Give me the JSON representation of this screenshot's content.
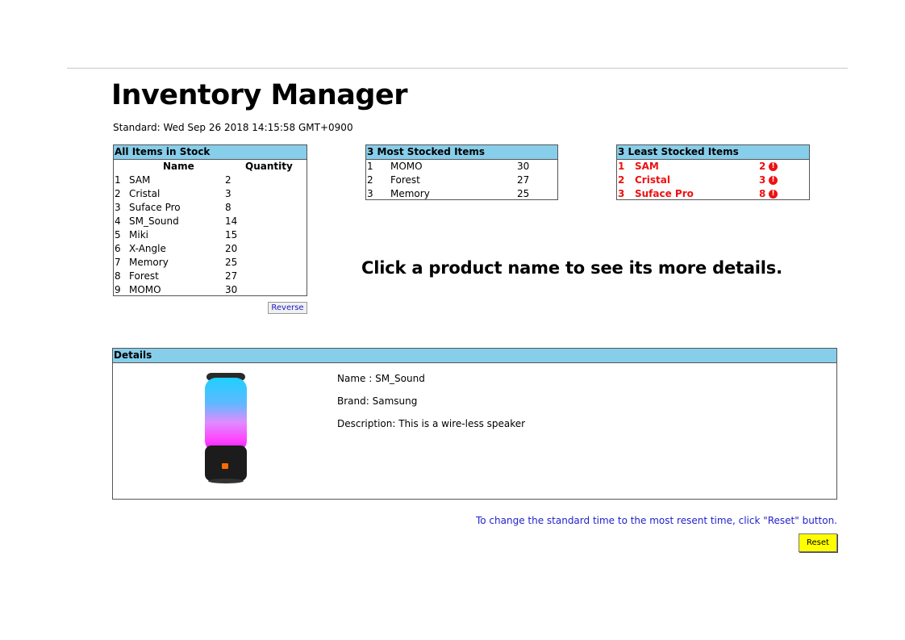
{
  "page": {
    "title": "Inventory Manager",
    "standard_time": "Standard: Wed Sep 26 2018 14:15:58 GMT+0900",
    "hint": "Click a product name to see its more details."
  },
  "all_items": {
    "header": "All Items in Stock",
    "col_name": "Name",
    "col_quantity": "Quantity",
    "rows": [
      {
        "index": "1",
        "name": "SAM",
        "quantity": "2"
      },
      {
        "index": "2",
        "name": "Cristal",
        "quantity": "3"
      },
      {
        "index": "3",
        "name": "Suface Pro",
        "quantity": "8"
      },
      {
        "index": "4",
        "name": "SM_Sound",
        "quantity": "14"
      },
      {
        "index": "5",
        "name": "Miki",
        "quantity": "15"
      },
      {
        "index": "6",
        "name": "X-Angle",
        "quantity": "20"
      },
      {
        "index": "7",
        "name": "Memory",
        "quantity": "25"
      },
      {
        "index": "8",
        "name": "Forest",
        "quantity": "27"
      },
      {
        "index": "9",
        "name": "MOMO",
        "quantity": "30"
      }
    ],
    "reverse_label": "Reverse"
  },
  "most_stocked": {
    "header": "3 Most Stocked Items",
    "rows": [
      {
        "index": "1",
        "name": "MOMO",
        "quantity": "30"
      },
      {
        "index": "2",
        "name": "Forest",
        "quantity": "27"
      },
      {
        "index": "3",
        "name": "Memory",
        "quantity": "25"
      }
    ]
  },
  "least_stocked": {
    "header": "3 Least Stocked Items",
    "alert_glyph": "!",
    "rows": [
      {
        "index": "1",
        "name": "SAM",
        "quantity": "2"
      },
      {
        "index": "2",
        "name": "Cristal",
        "quantity": "3"
      },
      {
        "index": "3",
        "name": "Suface Pro",
        "quantity": "8"
      }
    ]
  },
  "details": {
    "header": "Details",
    "name_line": "Name : SM_Sound",
    "brand_line": "Brand: Samsung",
    "description_line": "Description: This is a wire-less speaker",
    "image": "bluetooth-speaker-image"
  },
  "reset": {
    "note": "To change the standard time to the most resent time, click \"Reset\" button.",
    "label": "Reset"
  },
  "colors": {
    "header_bg": "#87ceeb",
    "alert_red": "#ee1111",
    "link_blue": "#2222cc",
    "reset_yellow": "#ffff00"
  }
}
